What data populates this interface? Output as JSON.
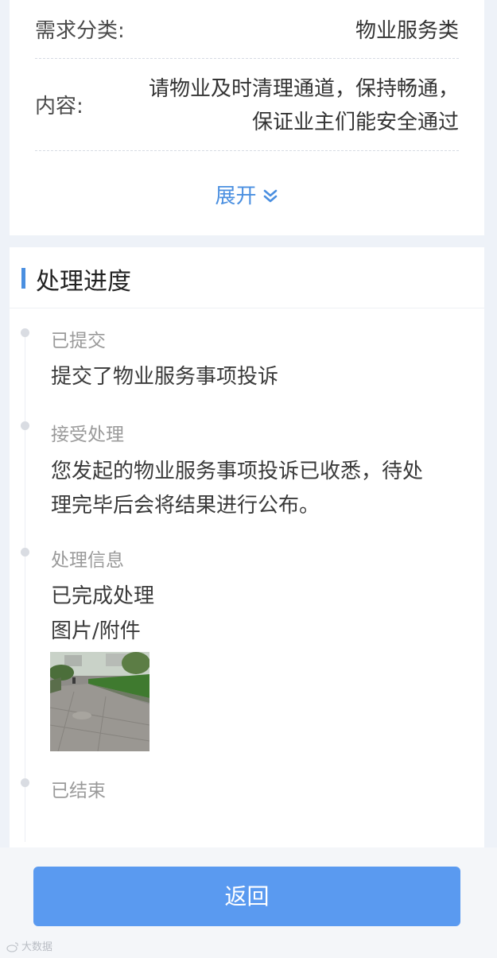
{
  "detail": {
    "category_label": "需求分类:",
    "category_value": "物业服务类",
    "content_label": "内容:",
    "content_line1": "请物业及时清理通道，保持畅通，",
    "content_line2": "保证业主们能安全通过",
    "expand_label": "展开",
    "expand_icon": "double-chevron-down-icon"
  },
  "progress": {
    "section_title": "处理进度",
    "steps": [
      {
        "title": "已提交",
        "lines": [
          "提交了物业服务事项投诉"
        ]
      },
      {
        "title": "接受处理",
        "lines": [
          "您发起的物业服务事项投诉已收悉，待处",
          "理完毕后会将结果进行公布。"
        ]
      },
      {
        "title": "处理信息",
        "lines": [
          "已完成处理",
          "图片/附件"
        ],
        "attachment": "photo-thumbnail"
      },
      {
        "title": "已结束",
        "lines": []
      }
    ]
  },
  "footer": {
    "back_label": "返回"
  },
  "watermark": {
    "text": "大数据"
  },
  "colors": {
    "accent": "#4a8fe0",
    "button": "#5a9af0",
    "page_bg": "#eef2f8"
  }
}
